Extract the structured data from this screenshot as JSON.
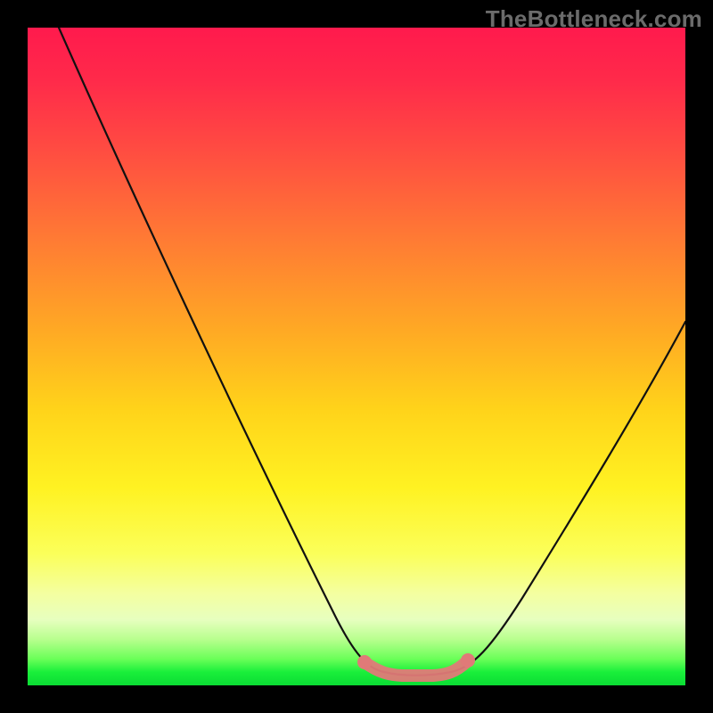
{
  "watermark": "TheBottleneck.com",
  "chart_data": {
    "type": "line",
    "title": "",
    "xlabel": "",
    "ylabel": "",
    "xlim": [
      0,
      100
    ],
    "ylim": [
      0,
      100
    ],
    "grid": false,
    "legend": false,
    "series": [
      {
        "name": "curve",
        "x": [
          5,
          10,
          15,
          20,
          25,
          30,
          35,
          40,
          45,
          50,
          52,
          54,
          56,
          58,
          60,
          62,
          64,
          66,
          70,
          75,
          80,
          85,
          90,
          95,
          100
        ],
        "y": [
          100,
          90,
          80,
          69,
          58,
          47,
          37,
          27,
          17,
          7,
          4,
          2,
          1,
          1,
          1,
          1,
          2,
          4,
          10,
          18,
          27,
          36,
          45,
          52,
          58
        ]
      }
    ],
    "annotations": [
      {
        "name": "optimal-zone",
        "x_range": [
          52,
          66
        ],
        "y": 2,
        "color": "#e07a78"
      }
    ]
  }
}
